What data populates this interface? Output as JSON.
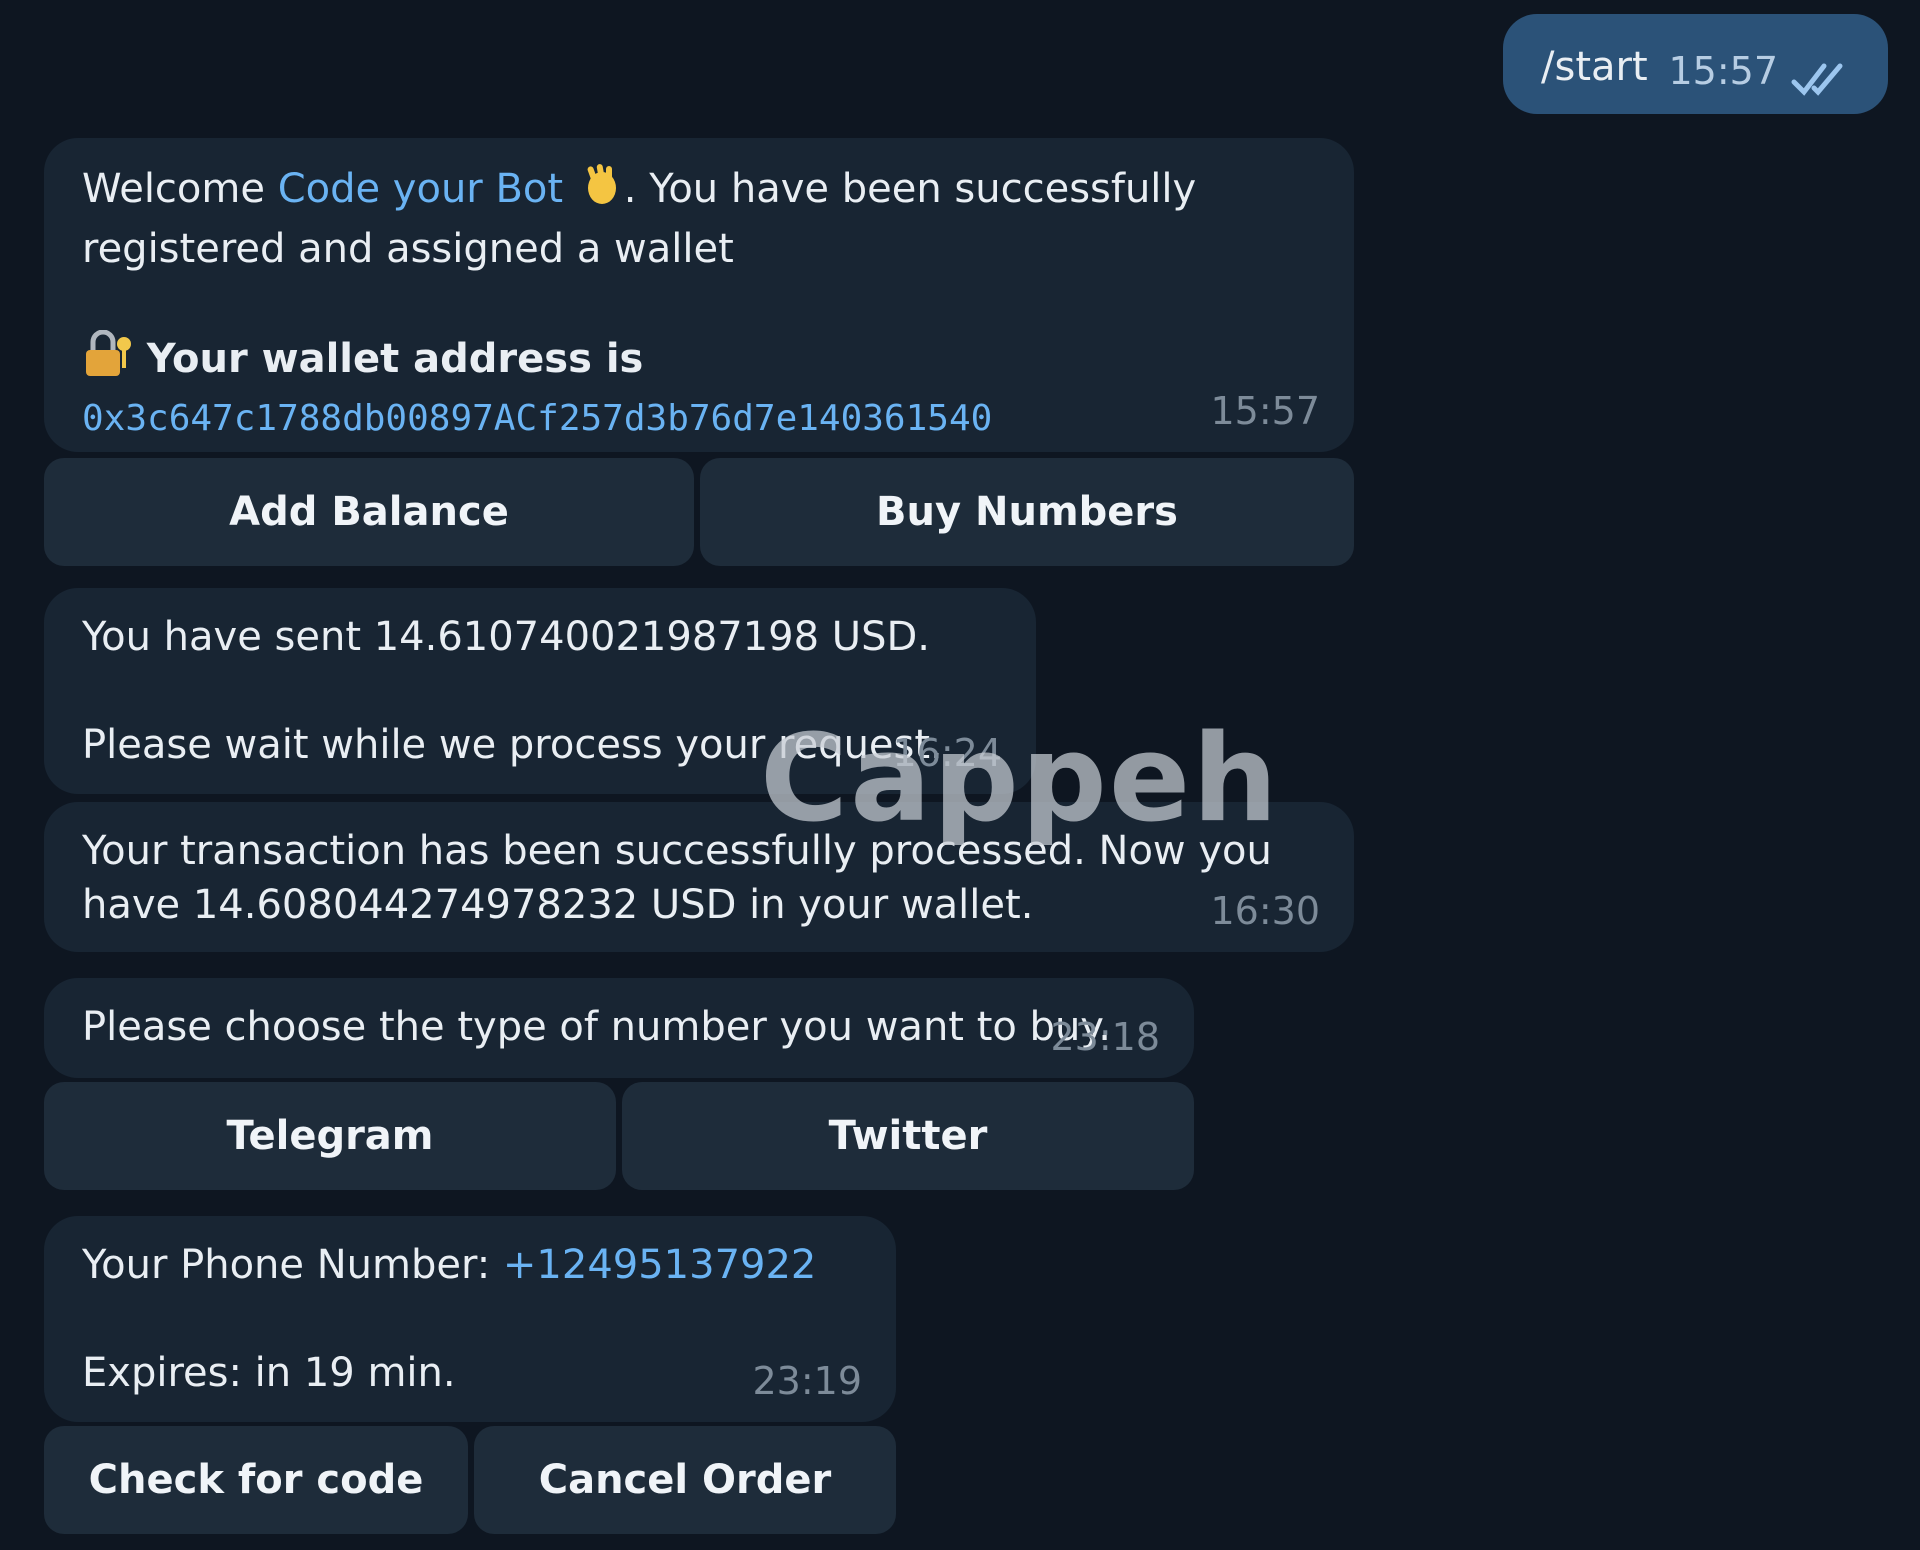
{
  "outgoing": {
    "text": "/start",
    "time": "15:57"
  },
  "welcome": {
    "prefix": "Welcome ",
    "bot_name": "Code your Bot",
    "suffix": ". You have been successfully registered and assigned a wallet",
    "wallet_label": "Your wallet address is",
    "wallet_address": "0x3c647c1788db00897ACf257d3b76d7e140361540",
    "time": "15:57",
    "wave_icon": "waving-hand-icon",
    "lock_icon": "locked-with-key-icon"
  },
  "welcome_buttons": {
    "add_balance": "Add Balance",
    "buy_numbers": "Buy Numbers"
  },
  "sent": {
    "line1": "You have sent 14.610740021987198 USD.",
    "line2": "Please wait while we process your request.",
    "time": "16:24"
  },
  "processed": {
    "text": "Your transaction has been successfully processed. Now you have 14.608044274978232 USD in your wallet.",
    "time": "16:30"
  },
  "choose": {
    "text": "Please choose the type of number you want to buy.",
    "time": "23:18"
  },
  "choose_buttons": {
    "telegram": "Telegram",
    "twitter": "Twitter"
  },
  "phone": {
    "label": "Your Phone Number: ",
    "number": "+12495137922",
    "expires": "Expires: in 19 min.",
    "time": "23:19"
  },
  "phone_buttons": {
    "check": "Check for code",
    "cancel": "Cancel Order"
  },
  "watermark": "Cappeh",
  "colors": {
    "background": "#0e1621",
    "bubble_in": "#182533",
    "bubble_out": "#2b5278",
    "link": "#6ab3f3"
  }
}
